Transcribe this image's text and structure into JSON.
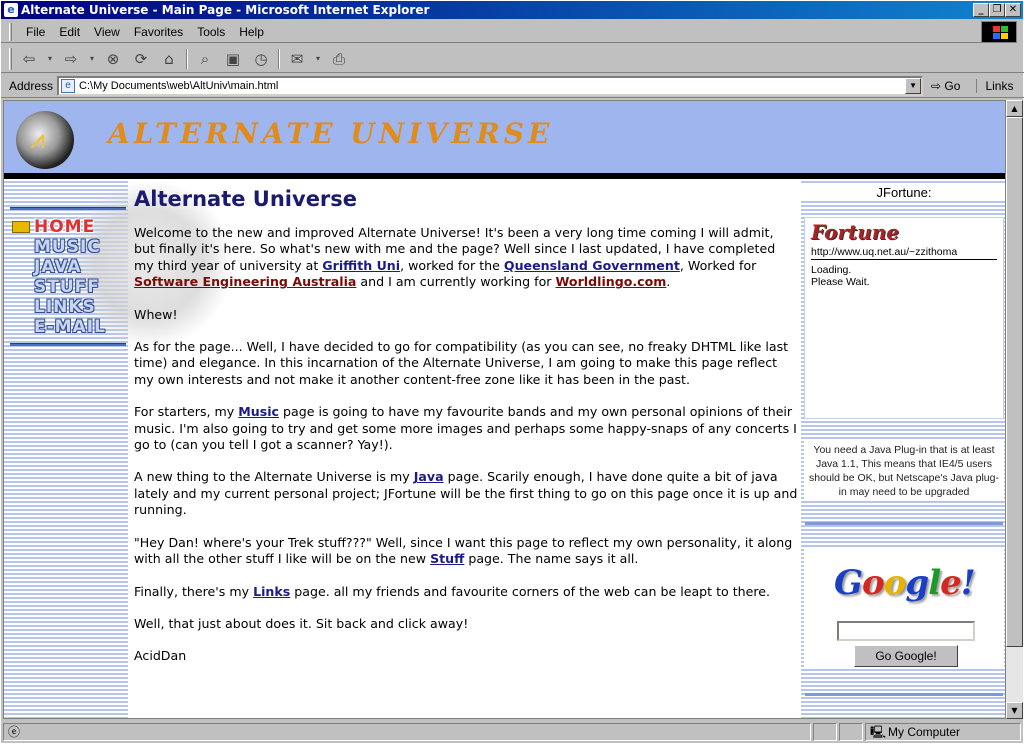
{
  "window": {
    "title": "Alternate Universe - Main Page - Microsoft Internet Explorer",
    "minimize": "_",
    "restore": "❐",
    "close": "✕"
  },
  "menu": [
    "File",
    "Edit",
    "View",
    "Favorites",
    "Tools",
    "Help"
  ],
  "toolbar": {
    "icons": [
      "back-arrow-icon",
      "forward-arrow-icon",
      "stop-icon",
      "refresh-icon",
      "home-icon",
      "search-icon",
      "favorites-icon",
      "history-icon",
      "mail-icon",
      "print-icon"
    ]
  },
  "address": {
    "label": "Address",
    "url": "C:\\My Documents\\web\\AltUniv\\main.html",
    "go": "Go",
    "links": "Links"
  },
  "page": {
    "site_name": "ALTERNATE UNIVERSE",
    "nav": [
      "HOME",
      "MUSIC",
      "JAVA",
      "STUFF",
      "LINKS",
      "E-MAIL"
    ],
    "heading": "Alternate Universe",
    "p1": {
      "t1": "Welcome to the new and improved Alternate Universe! It's been a very long time coming I will admit, but finally it's here. So what's new with me and the page? Well since I last updated, I have completed my third year of university at ",
      "l1": "Griffith Uni",
      "t2": ", worked for the ",
      "l2": "Queensland Government",
      "t3": ", Worked for ",
      "l3": "Software Engineering Australia",
      "t4": " and I am currently working for ",
      "l4": "Worldlingo.com",
      "t5": "."
    },
    "p2": "Whew!",
    "p3": "As for the page... Well, I have decided to go for compatibility (as you can see, no freaky DHTML like last time) and elegance. In this incarnation of the Alternate Universe, I am going to make this page reflect my own interests and not make it another content-free zone like it has been in the past.",
    "p4": {
      "t1": "For starters, my ",
      "l1": "Music",
      "t2": " page is going to have my favourite bands and my own personal opinions of their music. I'm also going to try and get some more images and perhaps some happy-snaps of any concerts I go to (can you tell I got a scanner? Yay!)."
    },
    "p5": {
      "t1": "A new thing to the Alternate Universe is my ",
      "l1": "Java",
      "t2": " page. Scarily enough, I have done quite a bit of java lately and my current personal project; JFortune will be the first thing to go on this page once it is up and running."
    },
    "p6": {
      "t1": "\"Hey Dan! where's your Trek stuff???\" Well, since I want this page to reflect my own personality, it along with all the other stuff I like will be on the new ",
      "l1": "Stuff",
      "t2": " page. The name says it all."
    },
    "p7": {
      "t1": "Finally, there's my ",
      "l1": "Links",
      "t2": " page. all my friends and favourite corners of the web can be leapt to there."
    },
    "p8": "Well, that just about does it. Sit back and click away!",
    "p9": "AcidDan",
    "jfortune": {
      "title": "JFortune:",
      "logo": "Fortune",
      "url": "http://www.uq.net.au/~zzithoma",
      "status1": "Loading.",
      "status2": "Please Wait."
    },
    "java_note": "You need a Java Plug-in that is at least Java 1.1, This means that IE4/5 users should be OK, but Netscape's Java plug-in may need to be upgraded",
    "google": {
      "logo_letters": [
        "G",
        "o",
        "o",
        "g",
        "l",
        "e",
        "!"
      ],
      "logo_colors": [
        "#1a3fc4",
        "#d7261e",
        "#e6b400",
        "#1a3fc4",
        "#1b9a2a",
        "#d7261e",
        "#1a3fc4"
      ],
      "search_value": "",
      "button": "Go Google!"
    }
  },
  "status": {
    "zone": "My Computer"
  }
}
